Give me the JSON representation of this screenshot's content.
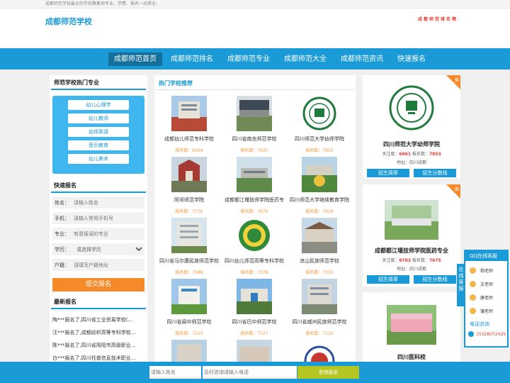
{
  "topbar": {
    "text": "成都师范学校最全的学校聚集地专业、学费、报名一齿俱全。"
  },
  "header": {
    "logo": "成都师范学校",
    "rank_title": "成都师范排名榜"
  },
  "nav": {
    "items": [
      "成都师范首页",
      "成都师范排名",
      "成都师范专业",
      "成都师范大全",
      "成都师范资讯",
      "快速报名"
    ]
  },
  "left": {
    "majors_title": "师范学校热门专业",
    "majors": [
      "幼儿心理学",
      "幼儿教师",
      "幼师英语",
      "音乐教育",
      "幼儿美术"
    ],
    "form_title": "快速报名",
    "form": {
      "name_label": "姓名：",
      "name_placeholder": "请输入姓名",
      "phone_label": "手机：",
      "phone_placeholder": "请输入常用手机号",
      "major_label": "专业：",
      "major_placeholder": "有意报读的专业",
      "edu_label": "学历：",
      "edu_value": "请选择学历",
      "hukou_label": "户籍：",
      "hukou_placeholder": "请填写户籍地址",
      "submit": "提交报名"
    },
    "news_title": "最新报名",
    "news": [
      "陶***报名了,四川省工业贸易学校(...",
      "汪***报名了,成都纺织高等专科学校...",
      "陈***报名了,四川省简阳市高级职业...",
      "白***报名了,四川托普信息技术职业..."
    ]
  },
  "mid": {
    "title": "热门学校推荐",
    "schools": [
      {
        "name": "成都幼儿师范专科学校",
        "count": "报名数：6164"
      },
      {
        "name": "四川省南充师范学校",
        "count": "报名数：7931"
      },
      {
        "name": "四川师范大学幼师学院",
        "count": "报名数：7853"
      },
      {
        "name": "阿坝师范学院",
        "count": "报名数：7776"
      },
      {
        "name": "成都都江堰技师学院医药专",
        "count": "报名数：7675"
      },
      {
        "name": "四川师范大学继续教育学院",
        "count": "报名数：7619"
      },
      {
        "name": "四川省马尔康民族师范学校",
        "count": "报名数：7588"
      },
      {
        "name": "四川幼儿师范高等专科学校",
        "count": "报名数：7378"
      },
      {
        "name": "凉山民族师范学校",
        "count": "报名数：7355"
      },
      {
        "name": "四川省阆中师范学校",
        "count": "报名数：7223"
      },
      {
        "name": "四川省巴中师范学校",
        "count": "报名数：7127"
      },
      {
        "name": "四川省威州民族师范学校",
        "count": "报名数：7123"
      }
    ]
  },
  "right": {
    "ribbon": "推",
    "cards": [
      {
        "name": "四川师范大学幼师学院",
        "attn_label": "关注度：",
        "attn": "6961",
        "reg_label": "报名数：",
        "reg": "7853",
        "addr": "地址：四川成都",
        "btn1": "招生简章",
        "btn2": "招生分数线"
      },
      {
        "name": "成都都江堰技师学院医药专业",
        "attn_label": "关注度：",
        "attn": "6783",
        "reg_label": "报名数：",
        "reg": "7675",
        "addr": "地址：四川成都",
        "btn1": "招生简章",
        "btn2": "招生分数线"
      },
      {
        "name": "四川医科校"
      }
    ]
  },
  "qq": {
    "title": "QQ在线客服",
    "tab": "在线客服",
    "agents": [
      "杨老师",
      "文老师",
      "唐老师",
      "蒲老师"
    ],
    "tel_title": "电话咨询",
    "tel": "15328072429"
  },
  "bottom": {
    "name_placeholder": "请输入姓名",
    "tel_placeholder": "及时咨询请输入电话",
    "submit": "咨询报名"
  },
  "colors": {
    "brand": "#1a9ad6",
    "accent": "#f58a2a",
    "red": "#e8372f",
    "lime": "#b5c622"
  }
}
